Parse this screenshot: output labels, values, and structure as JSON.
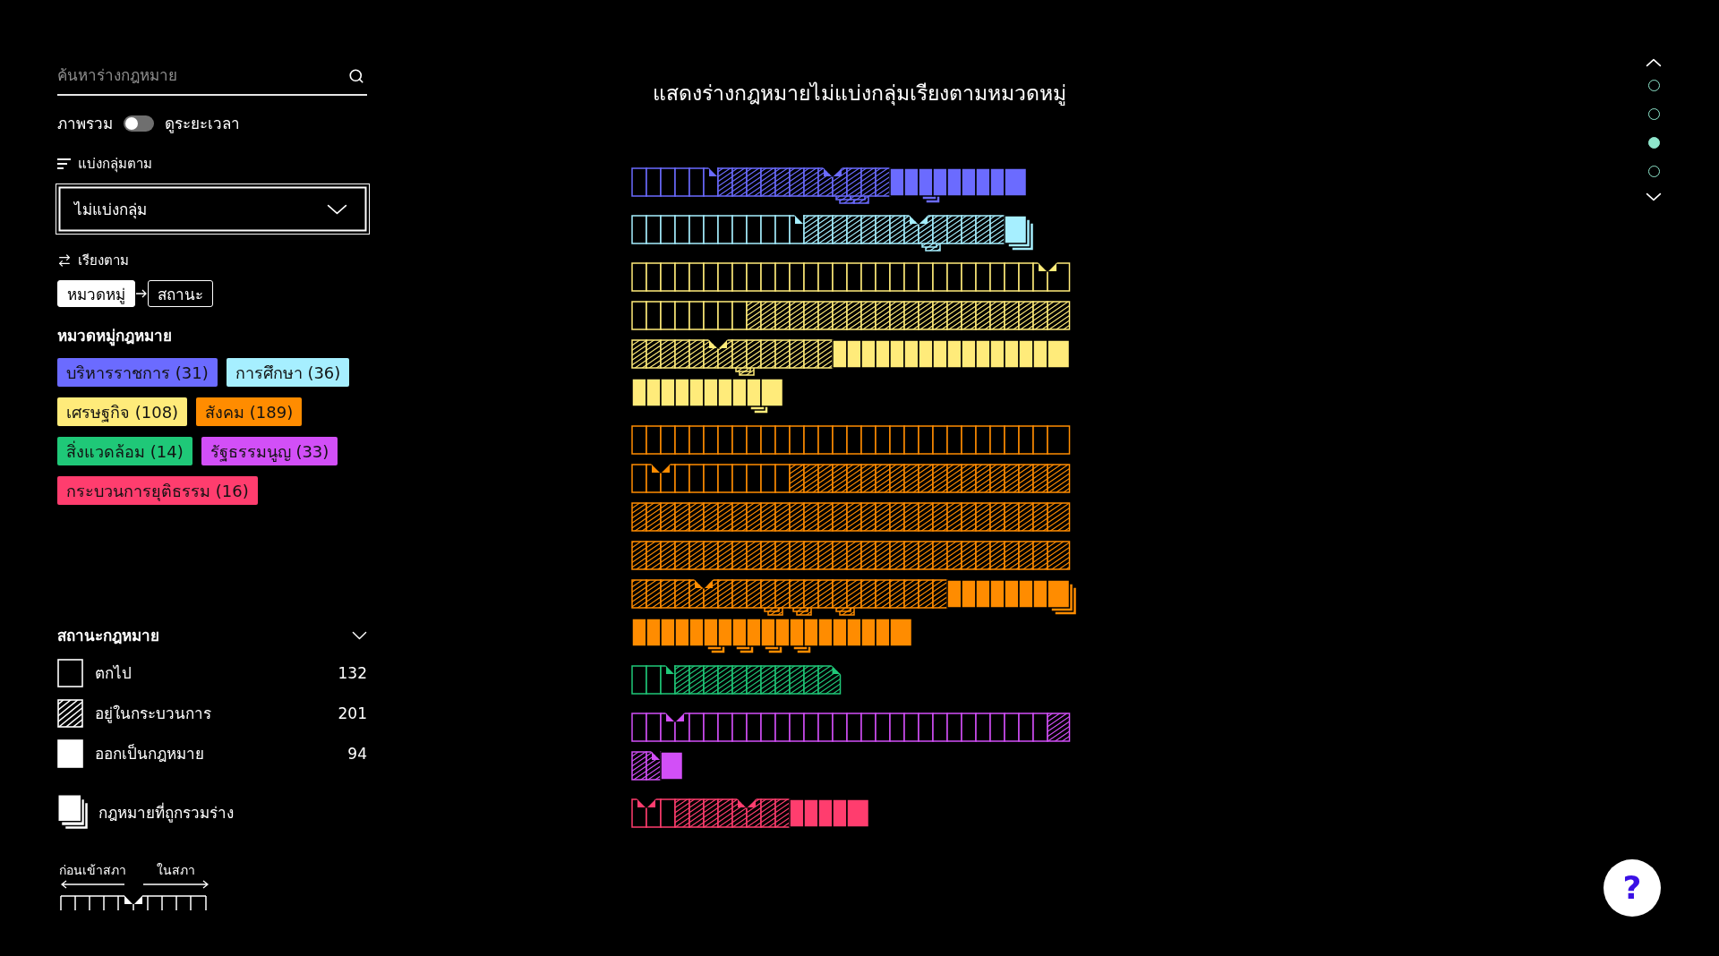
{
  "sidebar": {
    "search": {
      "placeholder": "ค้นหาร่างกฎหมาย"
    },
    "view_toggle": {
      "left_label": "ภาพรวม",
      "right_label": "ดูระยะเวลา",
      "on": false
    },
    "group_by": {
      "label": "แบ่งกลุ่มตาม",
      "value": "ไม่แบ่งกลุ่ม"
    },
    "sort_by": {
      "label": "เรียงตาม",
      "options": [
        {
          "label": "หมวดหมู่",
          "selected": true
        },
        {
          "label": "สถานะ",
          "selected": false
        }
      ]
    },
    "categories": {
      "title": "หมวดหมู่กฎหมาย",
      "items": [
        {
          "label": "บริหารราชการ (31)",
          "color": "#6b6bff"
        },
        {
          "label": "การศึกษา (36)",
          "color": "#a6efff"
        },
        {
          "label": "เศรษฐกิจ (108)",
          "color": "#ffeb7a"
        },
        {
          "label": "สังคม (189)",
          "color": "#ff8c00"
        },
        {
          "label": "สิ่งแวดล้อม (14)",
          "color": "#1fc878"
        },
        {
          "label": "รัฐธรรมนูญ (33)",
          "color": "#d24ff7"
        },
        {
          "label": "กระบวนการยุติธรรม (16)",
          "color": "#ff3d6e"
        }
      ]
    },
    "statuses": {
      "title": "สถานะกฎหมาย",
      "items": [
        {
          "kind": "fallen",
          "label": "ตกไป",
          "count": "132"
        },
        {
          "kind": "pending",
          "label": "อยู่ในกระบวนการ",
          "count": "201"
        },
        {
          "kind": "enacted",
          "label": "ออกเป็นกฎหมาย",
          "count": "94"
        }
      ]
    },
    "merged_legend": {
      "label": "กฎหมายที่ถูกรวมร่าง"
    },
    "stage_legend": {
      "before_label": "ก่อนเข้าสภา",
      "after_label": "ในสภา"
    }
  },
  "chart": {
    "title": "แสดงร่างกฎหมายไม่แบ่งกลุ่มเรียงตามหมวดหมู่",
    "groups": [
      {
        "color": "#6b6bff",
        "bills": [
          {
            "kind": "fallen"
          },
          {
            "kind": "fallen"
          },
          {
            "kind": "fallen"
          },
          {
            "kind": "fallen"
          },
          {
            "kind": "fallen"
          },
          {
            "kind": "fallen",
            "corner": true
          },
          {
            "kind": "pending"
          },
          {
            "kind": "pending"
          },
          {
            "kind": "pending"
          },
          {
            "kind": "pending"
          },
          {
            "kind": "pending"
          },
          {
            "kind": "pending"
          },
          {
            "kind": "pending"
          },
          {
            "kind": "pending",
            "notch": true
          },
          {
            "kind": "pending",
            "merged": true
          },
          {
            "kind": "pending",
            "merged": true
          },
          {
            "kind": "pending"
          },
          {
            "kind": "pending"
          },
          {
            "kind": "enacted"
          },
          {
            "kind": "enacted"
          },
          {
            "kind": "enacted",
            "merged": true
          },
          {
            "kind": "enacted"
          },
          {
            "kind": "enacted"
          },
          {
            "kind": "enacted"
          },
          {
            "kind": "enacted"
          },
          {
            "kind": "enacted"
          },
          {
            "kind": "enacted"
          }
        ]
      },
      {
        "color": "#a6efff",
        "bills": [
          {
            "kind": "fallen"
          },
          {
            "kind": "fallen"
          },
          {
            "kind": "fallen"
          },
          {
            "kind": "fallen"
          },
          {
            "kind": "fallen"
          },
          {
            "kind": "fallen"
          },
          {
            "kind": "fallen"
          },
          {
            "kind": "fallen"
          },
          {
            "kind": "fallen"
          },
          {
            "kind": "fallen"
          },
          {
            "kind": "fallen"
          },
          {
            "kind": "fallen",
            "corner": true
          },
          {
            "kind": "pending"
          },
          {
            "kind": "pending"
          },
          {
            "kind": "pending"
          },
          {
            "kind": "pending"
          },
          {
            "kind": "pending"
          },
          {
            "kind": "pending"
          },
          {
            "kind": "pending"
          },
          {
            "kind": "pending",
            "notch": true
          },
          {
            "kind": "pending",
            "merged": true
          },
          {
            "kind": "pending"
          },
          {
            "kind": "pending"
          },
          {
            "kind": "pending"
          },
          {
            "kind": "pending"
          },
          {
            "kind": "pending"
          },
          {
            "kind": "enacted",
            "merged": true
          }
        ]
      },
      {
        "color": "#ffeb7a",
        "bills": [
          {
            "kind": "fallen"
          },
          {
            "kind": "fallen"
          },
          {
            "kind": "fallen"
          },
          {
            "kind": "fallen"
          },
          {
            "kind": "fallen"
          },
          {
            "kind": "fallen"
          },
          {
            "kind": "fallen"
          },
          {
            "kind": "fallen"
          },
          {
            "kind": "fallen"
          },
          {
            "kind": "fallen"
          },
          {
            "kind": "fallen"
          },
          {
            "kind": "fallen"
          },
          {
            "kind": "fallen"
          },
          {
            "kind": "fallen"
          },
          {
            "kind": "fallen"
          },
          {
            "kind": "fallen"
          },
          {
            "kind": "fallen"
          },
          {
            "kind": "fallen"
          },
          {
            "kind": "fallen"
          },
          {
            "kind": "fallen"
          },
          {
            "kind": "fallen"
          },
          {
            "kind": "fallen"
          },
          {
            "kind": "fallen"
          },
          {
            "kind": "fallen"
          },
          {
            "kind": "fallen"
          },
          {
            "kind": "fallen"
          },
          {
            "kind": "fallen"
          },
          {
            "kind": "fallen"
          },
          {
            "kind": "fallen",
            "notch": true
          },
          {
            "kind": "fallen"
          },
          {
            "kind": "fallen"
          },
          {
            "kind": "fallen"
          },
          {
            "kind": "fallen"
          },
          {
            "kind": "fallen"
          },
          {
            "kind": "fallen"
          },
          {
            "kind": "fallen"
          },
          {
            "kind": "fallen"
          },
          {
            "kind": "fallen"
          },
          {
            "kind": "pending"
          },
          {
            "kind": "pending"
          },
          {
            "kind": "pending"
          },
          {
            "kind": "pending"
          },
          {
            "kind": "pending"
          },
          {
            "kind": "pending"
          },
          {
            "kind": "pending"
          },
          {
            "kind": "pending"
          },
          {
            "kind": "pending"
          },
          {
            "kind": "pending"
          },
          {
            "kind": "pending"
          },
          {
            "kind": "pending"
          },
          {
            "kind": "pending"
          },
          {
            "kind": "pending"
          },
          {
            "kind": "pending"
          },
          {
            "kind": "pending"
          },
          {
            "kind": "pending"
          },
          {
            "kind": "pending"
          },
          {
            "kind": "pending"
          },
          {
            "kind": "pending"
          },
          {
            "kind": "pending"
          },
          {
            "kind": "pending"
          },
          {
            "kind": "pending"
          },
          {
            "kind": "pending"
          },
          {
            "kind": "pending"
          },
          {
            "kind": "pending"
          },
          {
            "kind": "pending"
          },
          {
            "kind": "pending",
            "notch": true
          },
          {
            "kind": "pending"
          },
          {
            "kind": "pending",
            "merged": true
          },
          {
            "kind": "pending"
          },
          {
            "kind": "pending"
          },
          {
            "kind": "pending"
          },
          {
            "kind": "pending"
          },
          {
            "kind": "pending"
          },
          {
            "kind": "pending"
          },
          {
            "kind": "enacted"
          },
          {
            "kind": "enacted"
          },
          {
            "kind": "enacted"
          },
          {
            "kind": "enacted"
          },
          {
            "kind": "enacted"
          },
          {
            "kind": "enacted"
          },
          {
            "kind": "enacted"
          },
          {
            "kind": "enacted"
          },
          {
            "kind": "enacted"
          },
          {
            "kind": "enacted"
          },
          {
            "kind": "enacted"
          },
          {
            "kind": "enacted"
          },
          {
            "kind": "enacted"
          },
          {
            "kind": "enacted"
          },
          {
            "kind": "enacted"
          },
          {
            "kind": "enacted"
          },
          {
            "kind": "enacted"
          },
          {
            "kind": "enacted"
          },
          {
            "kind": "enacted"
          },
          {
            "kind": "enacted"
          },
          {
            "kind": "enacted"
          },
          {
            "kind": "enacted"
          },
          {
            "kind": "enacted"
          },
          {
            "kind": "enacted"
          },
          {
            "kind": "enacted",
            "merged": true
          },
          {
            "kind": "enacted"
          }
        ]
      },
      {
        "color": "#ff8c00",
        "bills": [
          {
            "kind": "fallen"
          },
          {
            "kind": "fallen"
          },
          {
            "kind": "fallen"
          },
          {
            "kind": "fallen"
          },
          {
            "kind": "fallen"
          },
          {
            "kind": "fallen"
          },
          {
            "kind": "fallen"
          },
          {
            "kind": "fallen"
          },
          {
            "kind": "fallen"
          },
          {
            "kind": "fallen"
          },
          {
            "kind": "fallen"
          },
          {
            "kind": "fallen"
          },
          {
            "kind": "fallen"
          },
          {
            "kind": "fallen"
          },
          {
            "kind": "fallen"
          },
          {
            "kind": "fallen"
          },
          {
            "kind": "fallen"
          },
          {
            "kind": "fallen"
          },
          {
            "kind": "fallen"
          },
          {
            "kind": "fallen"
          },
          {
            "kind": "fallen"
          },
          {
            "kind": "fallen"
          },
          {
            "kind": "fallen"
          },
          {
            "kind": "fallen"
          },
          {
            "kind": "fallen"
          },
          {
            "kind": "fallen"
          },
          {
            "kind": "fallen"
          },
          {
            "kind": "fallen"
          },
          {
            "kind": "fallen"
          },
          {
            "kind": "fallen"
          },
          {
            "kind": "fallen"
          },
          {
            "kind": "fallen",
            "notch": true
          },
          {
            "kind": "fallen"
          },
          {
            "kind": "fallen"
          },
          {
            "kind": "fallen"
          },
          {
            "kind": "fallen"
          },
          {
            "kind": "fallen"
          },
          {
            "kind": "fallen"
          },
          {
            "kind": "fallen"
          },
          {
            "kind": "fallen"
          },
          {
            "kind": "fallen"
          },
          {
            "kind": "pending"
          },
          {
            "kind": "pending"
          },
          {
            "kind": "pending"
          },
          {
            "kind": "pending"
          },
          {
            "kind": "pending"
          },
          {
            "kind": "pending"
          },
          {
            "kind": "pending"
          },
          {
            "kind": "pending"
          },
          {
            "kind": "pending"
          },
          {
            "kind": "pending"
          },
          {
            "kind": "pending"
          },
          {
            "kind": "pending"
          },
          {
            "kind": "pending"
          },
          {
            "kind": "pending"
          },
          {
            "kind": "pending"
          },
          {
            "kind": "pending"
          },
          {
            "kind": "pending"
          },
          {
            "kind": "pending"
          },
          {
            "kind": "pending"
          },
          {
            "kind": "pending"
          },
          {
            "kind": "pending"
          },
          {
            "kind": "pending"
          },
          {
            "kind": "pending"
          },
          {
            "kind": "pending"
          },
          {
            "kind": "pending"
          },
          {
            "kind": "pending"
          },
          {
            "kind": "pending"
          },
          {
            "kind": "pending"
          },
          {
            "kind": "pending"
          },
          {
            "kind": "pending"
          },
          {
            "kind": "pending"
          },
          {
            "kind": "pending"
          },
          {
            "kind": "pending"
          },
          {
            "kind": "pending"
          },
          {
            "kind": "pending"
          },
          {
            "kind": "pending"
          },
          {
            "kind": "pending"
          },
          {
            "kind": "pending"
          },
          {
            "kind": "pending"
          },
          {
            "kind": "pending"
          },
          {
            "kind": "pending"
          },
          {
            "kind": "pending"
          },
          {
            "kind": "pending"
          },
          {
            "kind": "pending"
          },
          {
            "kind": "pending"
          },
          {
            "kind": "pending"
          },
          {
            "kind": "pending"
          },
          {
            "kind": "pending"
          },
          {
            "kind": "pending"
          },
          {
            "kind": "pending"
          },
          {
            "kind": "pending"
          },
          {
            "kind": "pending"
          },
          {
            "kind": "pending"
          },
          {
            "kind": "pending"
          },
          {
            "kind": "pending"
          },
          {
            "kind": "pending"
          },
          {
            "kind": "pending"
          },
          {
            "kind": "pending"
          },
          {
            "kind": "pending"
          },
          {
            "kind": "pending"
          },
          {
            "kind": "pending"
          },
          {
            "kind": "pending"
          },
          {
            "kind": "pending"
          },
          {
            "kind": "pending"
          },
          {
            "kind": "pending"
          },
          {
            "kind": "pending"
          },
          {
            "kind": "pending"
          },
          {
            "kind": "pending"
          },
          {
            "kind": "pending"
          },
          {
            "kind": "pending"
          },
          {
            "kind": "pending"
          },
          {
            "kind": "pending"
          },
          {
            "kind": "pending"
          },
          {
            "kind": "pending"
          },
          {
            "kind": "pending"
          },
          {
            "kind": "pending"
          },
          {
            "kind": "pending"
          },
          {
            "kind": "pending"
          },
          {
            "kind": "pending"
          },
          {
            "kind": "pending"
          },
          {
            "kind": "pending"
          },
          {
            "kind": "pending"
          },
          {
            "kind": "pending"
          },
          {
            "kind": "pending",
            "notch": true
          },
          {
            "kind": "pending"
          },
          {
            "kind": "pending"
          },
          {
            "kind": "pending"
          },
          {
            "kind": "pending"
          },
          {
            "kind": "pending",
            "merged": true
          },
          {
            "kind": "pending"
          },
          {
            "kind": "pending",
            "merged": true
          },
          {
            "kind": "pending"
          },
          {
            "kind": "pending"
          },
          {
            "kind": "pending",
            "merged": true
          },
          {
            "kind": "pending"
          },
          {
            "kind": "pending"
          },
          {
            "kind": "pending"
          },
          {
            "kind": "pending"
          },
          {
            "kind": "pending"
          },
          {
            "kind": "pending"
          },
          {
            "kind": "pending"
          },
          {
            "kind": "enacted"
          },
          {
            "kind": "enacted"
          },
          {
            "kind": "enacted"
          },
          {
            "kind": "enacted"
          },
          {
            "kind": "enacted"
          },
          {
            "kind": "enacted"
          },
          {
            "kind": "enacted"
          },
          {
            "kind": "enacted",
            "merged": true
          },
          {
            "kind": "enacted"
          },
          {
            "kind": "enacted"
          },
          {
            "kind": "enacted"
          },
          {
            "kind": "enacted"
          },
          {
            "kind": "enacted"
          },
          {
            "kind": "enacted",
            "merged": true
          },
          {
            "kind": "enacted"
          },
          {
            "kind": "enacted",
            "merged": true
          },
          {
            "kind": "enacted"
          },
          {
            "kind": "enacted",
            "merged": true
          },
          {
            "kind": "enacted"
          },
          {
            "kind": "enacted",
            "merged": true
          },
          {
            "kind": "enacted"
          },
          {
            "kind": "enacted"
          },
          {
            "kind": "enacted"
          },
          {
            "kind": "enacted"
          },
          {
            "kind": "enacted"
          },
          {
            "kind": "enacted"
          },
          {
            "kind": "enacted"
          }
        ]
      },
      {
        "color": "#1fc878",
        "bills": [
          {
            "kind": "fallen"
          },
          {
            "kind": "fallen"
          },
          {
            "kind": "fallen",
            "corner": true
          },
          {
            "kind": "pending"
          },
          {
            "kind": "pending"
          },
          {
            "kind": "pending"
          },
          {
            "kind": "pending"
          },
          {
            "kind": "pending"
          },
          {
            "kind": "pending"
          },
          {
            "kind": "pending"
          },
          {
            "kind": "pending"
          },
          {
            "kind": "pending"
          },
          {
            "kind": "pending"
          },
          {
            "kind": "pending",
            "corner": true
          }
        ]
      },
      {
        "color": "#d24ff7",
        "bills": [
          {
            "kind": "fallen"
          },
          {
            "kind": "fallen"
          },
          {
            "kind": "fallen",
            "notch": true
          },
          {
            "kind": "fallen"
          },
          {
            "kind": "fallen"
          },
          {
            "kind": "fallen"
          },
          {
            "kind": "fallen"
          },
          {
            "kind": "fallen"
          },
          {
            "kind": "fallen"
          },
          {
            "kind": "fallen"
          },
          {
            "kind": "fallen"
          },
          {
            "kind": "fallen"
          },
          {
            "kind": "fallen"
          },
          {
            "kind": "fallen"
          },
          {
            "kind": "fallen"
          },
          {
            "kind": "fallen"
          },
          {
            "kind": "fallen"
          },
          {
            "kind": "fallen"
          },
          {
            "kind": "fallen"
          },
          {
            "kind": "fallen"
          },
          {
            "kind": "fallen"
          },
          {
            "kind": "fallen"
          },
          {
            "kind": "fallen"
          },
          {
            "kind": "fallen"
          },
          {
            "kind": "fallen"
          },
          {
            "kind": "fallen"
          },
          {
            "kind": "fallen"
          },
          {
            "kind": "fallen"
          },
          {
            "kind": "fallen"
          },
          {
            "kind": "pending"
          },
          {
            "kind": "pending"
          },
          {
            "kind": "pending",
            "corner": true
          },
          {
            "kind": "enacted"
          }
        ]
      },
      {
        "color": "#ff3d6e",
        "bills": [
          {
            "kind": "fallen",
            "notch": true
          },
          {
            "kind": "fallen"
          },
          {
            "kind": "fallen"
          },
          {
            "kind": "pending"
          },
          {
            "kind": "pending"
          },
          {
            "kind": "pending"
          },
          {
            "kind": "pending"
          },
          {
            "kind": "pending",
            "notch": true
          },
          {
            "kind": "pending"
          },
          {
            "kind": "pending"
          },
          {
            "kind": "pending"
          },
          {
            "kind": "enacted"
          },
          {
            "kind": "enacted"
          },
          {
            "kind": "enacted"
          },
          {
            "kind": "enacted"
          },
          {
            "kind": "enacted"
          }
        ]
      }
    ]
  },
  "section_nav": {
    "dots": [
      {
        "selected": false
      },
      {
        "selected": false
      },
      {
        "selected": true
      },
      {
        "selected": false
      }
    ]
  },
  "help_button": {
    "label": "?"
  }
}
